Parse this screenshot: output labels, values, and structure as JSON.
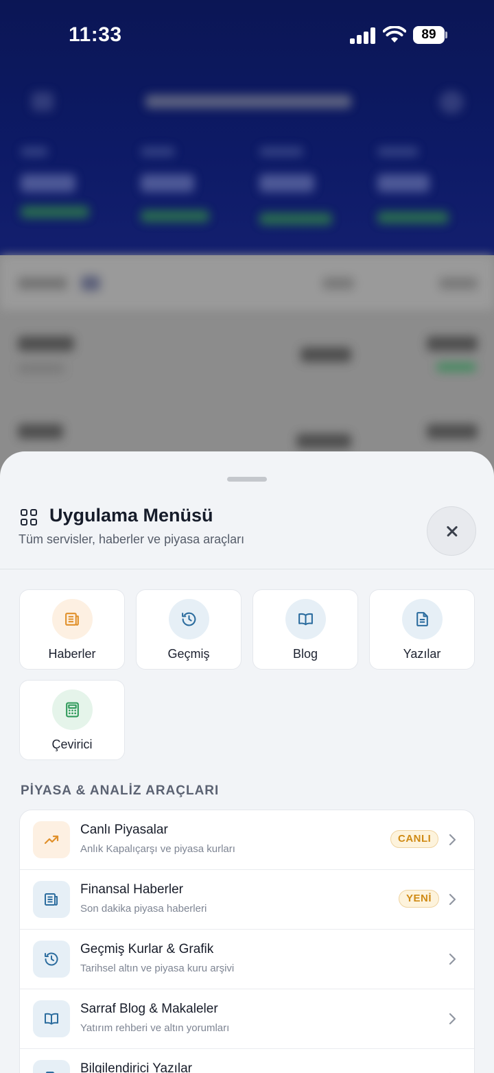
{
  "status_bar": {
    "time": "11:33",
    "battery": "89"
  },
  "sheet": {
    "title": "Uygulama Menüsü",
    "subtitle": "Tüm servisler, haberler ve piyasa araçları"
  },
  "tiles": [
    {
      "label": "Haberler",
      "icon": "newspaper-icon",
      "color": "#e0902a",
      "bg": "#fdf0e2"
    },
    {
      "label": "Geçmiş",
      "icon": "history-icon",
      "color": "#2b6c9e",
      "bg": "#e6eff6"
    },
    {
      "label": "Blog",
      "icon": "book-icon",
      "color": "#2b6c9e",
      "bg": "#e6eff6"
    },
    {
      "label": "Yazılar",
      "icon": "document-icon",
      "color": "#2b6c9e",
      "bg": "#e6eff6"
    },
    {
      "label": "Çevirici",
      "icon": "calculator-icon",
      "color": "#2f9a5a",
      "bg": "#e5f4ea"
    }
  ],
  "section_title": "PİYASA & ANALİZ ARAÇLARI",
  "tools": [
    {
      "title": "Canlı Piyasalar",
      "subtitle": "Anlık Kapalıçarşı ve piyasa kurları",
      "badge": "CANLI",
      "icon": "trending-up-icon"
    },
    {
      "title": "Finansal Haberler",
      "subtitle": "Son dakika piyasa haberleri",
      "badge": "YENİ",
      "icon": "newspaper-icon"
    },
    {
      "title": "Geçmiş Kurlar & Grafik",
      "subtitle": "Tarihsel altın ve piyasa kuru arşivi",
      "badge": "",
      "icon": "history-icon"
    },
    {
      "title": "Sarraf Blog & Makaleler",
      "subtitle": "Yatırım rehberi ve altın yorumları",
      "badge": "",
      "icon": "book-icon"
    },
    {
      "title": "Bilgilendirici Yazılar",
      "subtitle": "",
      "badge": "",
      "icon": "document-icon"
    }
  ],
  "colors": {
    "accent_orange": "#e0902a",
    "accent_blue": "#2b6c9e",
    "accent_green": "#2f9a5a",
    "badge_bg": "#fdf3dc",
    "badge_border": "#efd3a0"
  }
}
